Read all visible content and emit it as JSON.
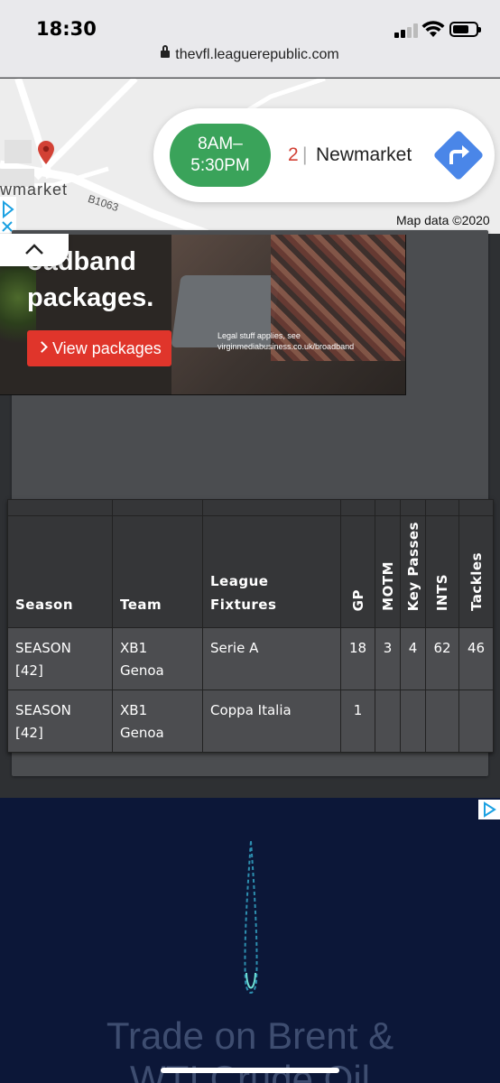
{
  "status": {
    "time": "18:30",
    "url": "thevfl.leaguerepublic.com"
  },
  "map_ad": {
    "place_name": "wmarket",
    "road_label": "B1063",
    "hours": "8AM–\n5:30PM",
    "hours_line1": "8AM–",
    "hours_line2": "5:30PM",
    "rank": "2",
    "separator": "|",
    "town": "Newmarket",
    "attribution": "Map data ©2020",
    "colors": {
      "hours_pill": "#3aa35a",
      "direction": "#4a86e8",
      "rank": "#d24135"
    },
    "icons": [
      "adchoices-icon",
      "map-pin-icon",
      "directions-icon"
    ]
  },
  "promo_ad": {
    "headline_line1": "oadband",
    "headline_line2": "packages.",
    "button_label": "View packages",
    "legal_line1": "Legal stuff applies, see",
    "legal_line2": "virginmediabusiness.co.uk/broadband",
    "button_color": "#e0352b"
  },
  "stats_table": {
    "headers": {
      "season": "Season",
      "team": "Team",
      "fixtures_line1": "League",
      "fixtures_line2": "Fixtures",
      "gp": "GP",
      "motm": "MOTM",
      "key_passes": "Key Passes",
      "ints": "INTS",
      "tackles": "Tackles"
    },
    "rows": [
      {
        "season_line1": "SEASON",
        "season_line2": "[42]",
        "team_line1": "XB1",
        "team_line2": "Genoa",
        "fixture": "Serie A",
        "gp": "18",
        "motm": "3",
        "key_passes": "4",
        "ints": "62",
        "tackles": "46"
      },
      {
        "season_line1": "SEASON",
        "season_line2": "[42]",
        "team_line1": "XB1",
        "team_line2": "Genoa",
        "fixture": "Coppa Italia",
        "gp": "1",
        "motm": "",
        "key_passes": "",
        "ints": "",
        "tackles": ""
      }
    ]
  },
  "bottom_ad": {
    "text_line1": "Trade on Brent &",
    "text_line2": "WTI Crude Oil"
  }
}
